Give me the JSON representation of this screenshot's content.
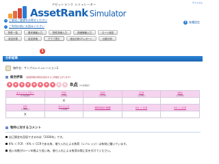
{
  "header": {
    "user_label": "ゲストさん",
    "logo_subtitle": "アセットランク シミュレーター",
    "logo_brand": "AssetRank",
    "logo_brand_suffix": "Simulator",
    "help_label": "各種設定"
  },
  "links": [
    "ご意見ご要望をお寄せください",
    "ご利用の前にお読みください"
  ],
  "tabs_row1": [
    "物件一覧",
    "基本情報入力",
    "物件詳細入力",
    "詳細情報入力",
    "ローン設定",
    "収支計算"
  ],
  "tabs_row2": [
    "収支詳細",
    "グラフ表示",
    "総合分析CFレポート",
    "比較分析"
  ],
  "marker": "1",
  "section_title": "分析結果",
  "property": {
    "label": "物件名：サンプルシミュレーション2"
  },
  "rating": {
    "title": "総合評価",
    "note": "（最低評価の項目を改善すると評価が上がります）",
    "stars_on": 8,
    "stars_total": 10,
    "score": "8点",
    "score_suffix": "（10点満点）"
  },
  "table": {
    "row1": [
      {
        "title": "キャッシュフロー",
        "cond": "（＞0円/年）"
      },
      {
        "title": "FCR",
        "cond": "（＞k%）"
      },
      {
        "title": "DCR",
        "cond": "（＞1.3）"
      },
      {
        "title": "CCR",
        "cond": "（＞0%）"
      },
      {
        "title": "BE%",
        "cond": "（＜70%）"
      }
    ],
    "marks1": [
      "",
      "×",
      "",
      "",
      ""
    ],
    "row2": [
      {
        "title": "LTV",
        "cond": "（＜80%）"
      },
      {
        "title": "ペイバック",
        "cond": "（＜10年）"
      },
      {
        "title": "物件利回り指標",
        "cond": ""
      },
      {
        "title": "K% ＜ FCR",
        "cond": ""
      },
      {
        "title": "K% ＜ CCR",
        "cond": ""
      }
    ],
    "marks2": [
      "×",
      "",
      "",
      "",
      ""
    ]
  },
  "comment": {
    "title": "物件に対するコメント",
    "items": [
      "自己資金を回収できるのは「2036年」です。",
      "K% ＜ FCR ・K% ＜ CCRである為、借り入れによる負荷（レバレッジ）は有効に働いています。",
      "借入年数がローン年数より長い為、借り入れによる負荷の際に気を付けてください。"
    ]
  }
}
